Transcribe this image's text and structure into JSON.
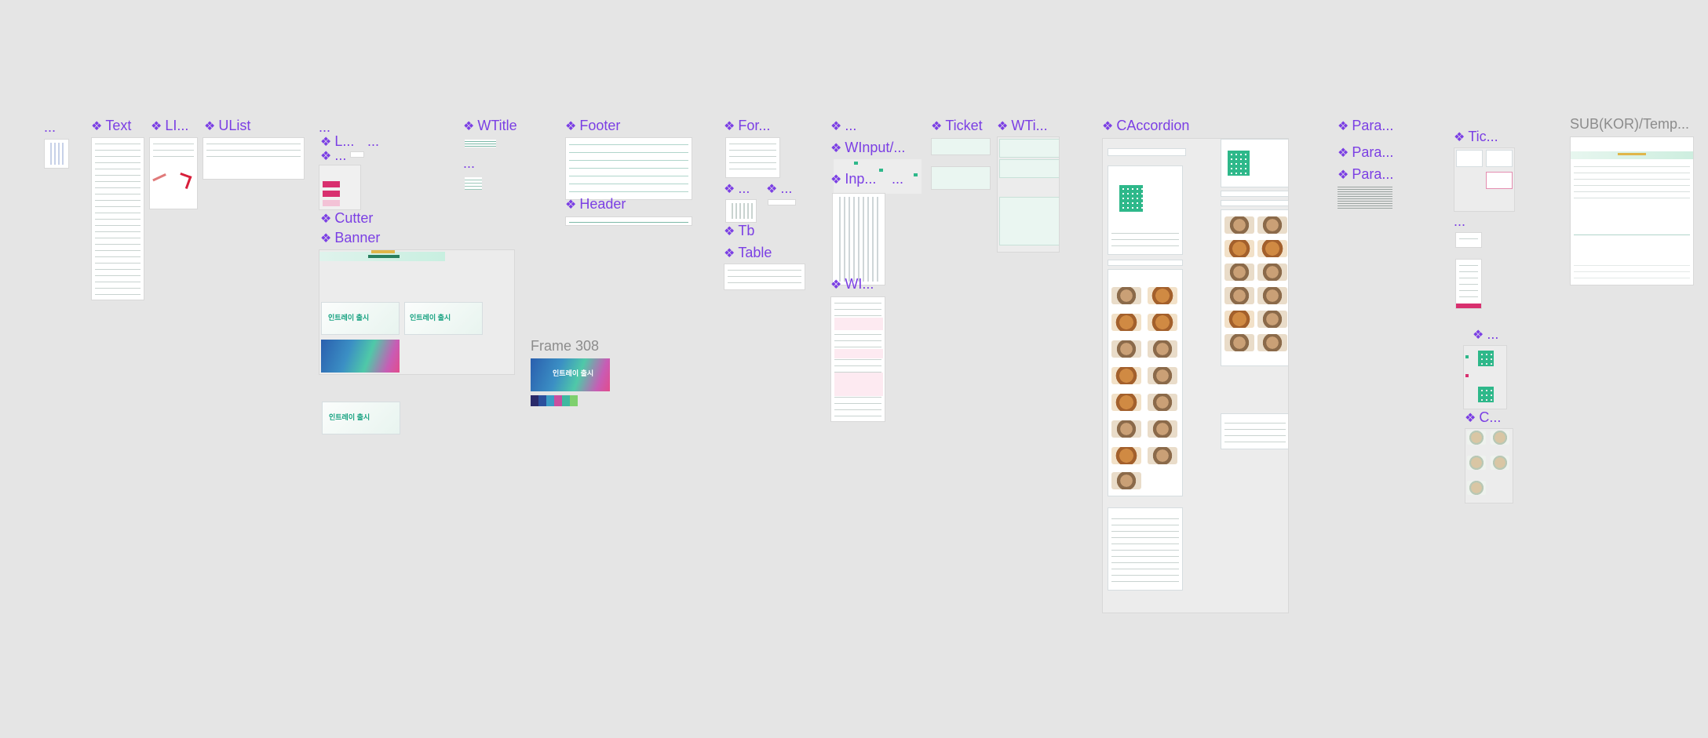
{
  "canvas": {
    "background": "#e5e5e5",
    "accent": "#7b3fe4",
    "brand_green": "#17a281",
    "brand_pink": "#d8306f"
  },
  "labels": {
    "l_dots1": "...",
    "l_text": "Text",
    "l_li": "LI...",
    "l_ulist": "UList",
    "l_dots2": "...",
    "l_l": "L...",
    "l_dots3": "...",
    "l_dots4": "...",
    "l_cutter": "Cutter",
    "l_banner": "Banner",
    "l_wtitle": "WTitle",
    "l_dots5": "...",
    "l_footer": "Footer",
    "l_header": "Header",
    "l_for": "For...",
    "l_dots6": "...",
    "l_dots7": "...",
    "l_tb": "Tb",
    "l_table": "Table",
    "l_dots8": "...",
    "l_winput": "WInput/...",
    "l_inp": "Inp...",
    "l_dots9": "...",
    "l_wi": "WI...",
    "l_ticket": "Ticket",
    "l_wti": "WTi...",
    "l_caccordion": "CAccordion",
    "l_para1": "Para...",
    "l_para2": "Para...",
    "l_para3": "Para...",
    "l_tic": "Tic...",
    "l_dots10": "...",
    "l_dots11": "...",
    "l_c": "C...",
    "l_frame308": "Frame 308",
    "l_subkor": "SUB(KOR)/Temp..."
  },
  "banner_text": {
    "launch": "인트레이 출시"
  },
  "palette_swatches": [
    "#2a2a6a",
    "#2b4f9c",
    "#3a9cc4",
    "#c84f9f",
    "#3fb8a0",
    "#7ed06e"
  ],
  "icons": {
    "component": "component-diamond-icon"
  }
}
